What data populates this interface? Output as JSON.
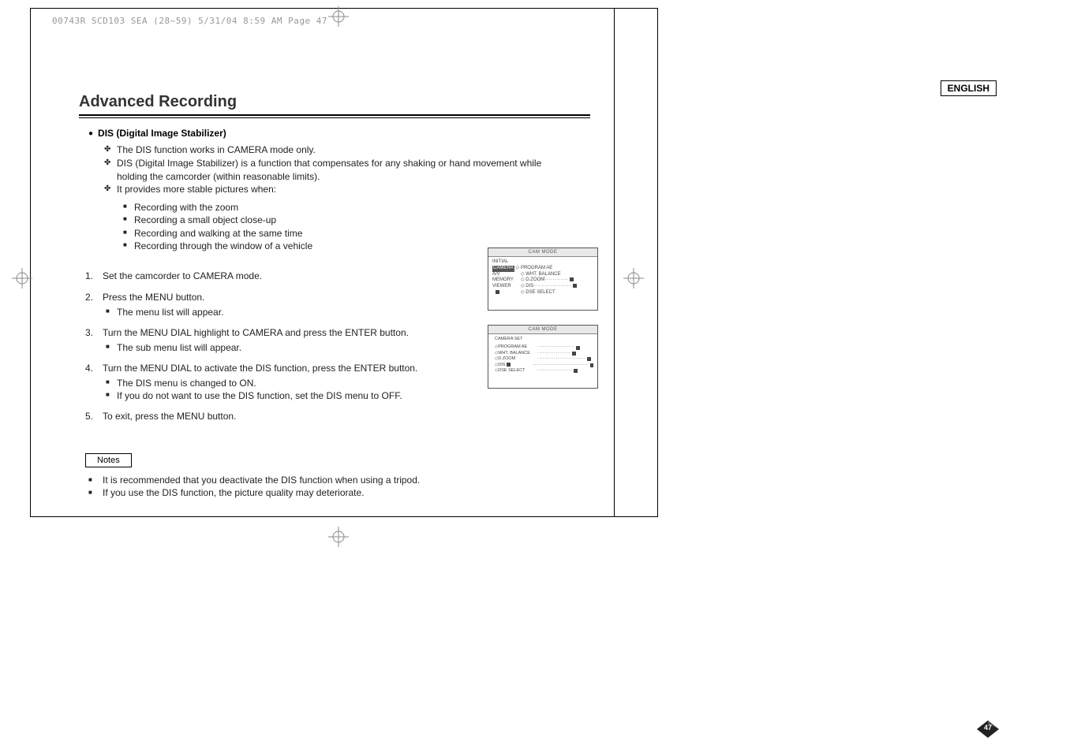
{
  "header": {
    "file_info": "00743R SCD103 SEA (28~59)  5/31/04 8:59 AM  Page 47"
  },
  "language_label": "ENGLISH",
  "title": "Advanced Recording",
  "section_title": "DIS (Digital Image Stabilizer)",
  "plus_items": [
    "The DIS function works in CAMERA mode only.",
    "DIS (Digital Image Stabilizer) is a function that compensates for any shaking or hand movement while holding the camcorder (within reasonable limits).",
    "It provides more stable pictures when:"
  ],
  "stable_when": [
    "Recording with the zoom",
    "Recording a small object close-up",
    "Recording and walking at the same time",
    "Recording through the window of a vehicle"
  ],
  "steps": [
    {
      "n": "1.",
      "text": "Set the camcorder to CAMERA mode."
    },
    {
      "n": "2.",
      "text": "Press the MENU button.",
      "subs": [
        "The menu list will appear."
      ]
    },
    {
      "n": "3.",
      "text": "Turn the MENU DIAL highlight to CAMERA and press the ENTER button.",
      "subs": [
        "The sub menu list will appear."
      ]
    },
    {
      "n": "4.",
      "text": "Turn the MENU DIAL to activate the DIS function, press the ENTER button.",
      "subs": [
        "The DIS menu is changed to ON.",
        "If you do not want to use the DIS function, set the DIS menu to OFF."
      ]
    },
    {
      "n": "5.",
      "text": "To exit, press the MENU button."
    }
  ],
  "notes_label": "Notes",
  "notes": [
    "It is recommended that you deactivate the DIS function when using a tripod.",
    "If you use the DIS function, the picture quality may deteriorate."
  ],
  "menu1": {
    "title": "CAM  MODE",
    "left": [
      "INITIAL",
      "CAMERA",
      "A/V",
      "MEMORY",
      "VIEWER"
    ],
    "right": [
      "PROGRAM AE",
      "WHT. BALANCE",
      "D.ZOOM",
      "DIS",
      "DSE SELECT"
    ]
  },
  "menu2": {
    "title": "CAM  MODE",
    "header": "CAMERA SET",
    "items": [
      "PROGRAM AE",
      "WHT. BALANCE",
      "D.ZOOM",
      "DIS",
      "DSE SELECT"
    ]
  },
  "page_number": "47"
}
